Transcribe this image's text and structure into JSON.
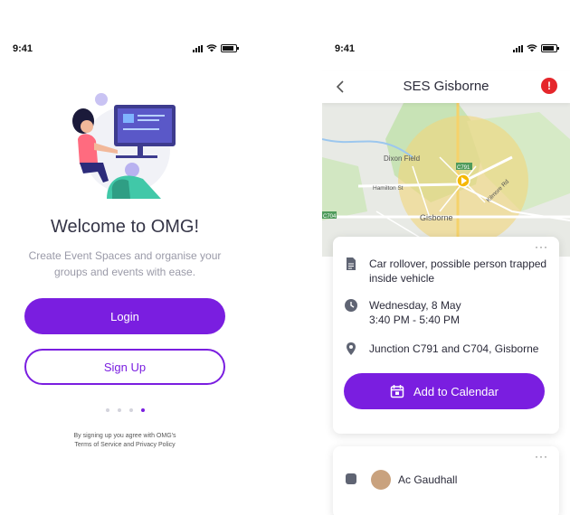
{
  "status": {
    "time": "9:41"
  },
  "welcome_screen": {
    "title": "Welcome to OMG!",
    "subtitle": "Create Event Spaces and organise your groups and events with ease.",
    "login_label": "Login",
    "signup_label": "Sign Up",
    "pagination": {
      "total": 4,
      "active_index": 3
    },
    "legal_line1": "By signing up you agree with OMG's",
    "legal_line2": "Terms of Service and Privacy Policy"
  },
  "event_screen": {
    "title": "SES Gisborne",
    "alert_glyph": "!",
    "map": {
      "labels": {
        "dixon_field": "Dixon Field",
        "hamilton_st": "Hamilton St",
        "kilmore_rd": "Kilmore Rd",
        "gisborne": "Gisborne",
        "c791": "C791",
        "c704": "C704",
        "orne": "orne"
      }
    },
    "event_card": {
      "more": "···",
      "description": "Car rollover, possible person trapped inside vehicle",
      "date": "Wednesday, 8 May",
      "time_range": "3:40 PM - 5:40 PM",
      "location": "Junction C791 and C704, Gisborne",
      "add_to_calendar_label": "Add to Calendar"
    },
    "next_card": {
      "more": "···",
      "name_partial": "Ac Gaudhall"
    }
  },
  "colors": {
    "accent": "#7a1ee0",
    "alert": "#e5262b",
    "map_circle": "#f2d67a"
  }
}
